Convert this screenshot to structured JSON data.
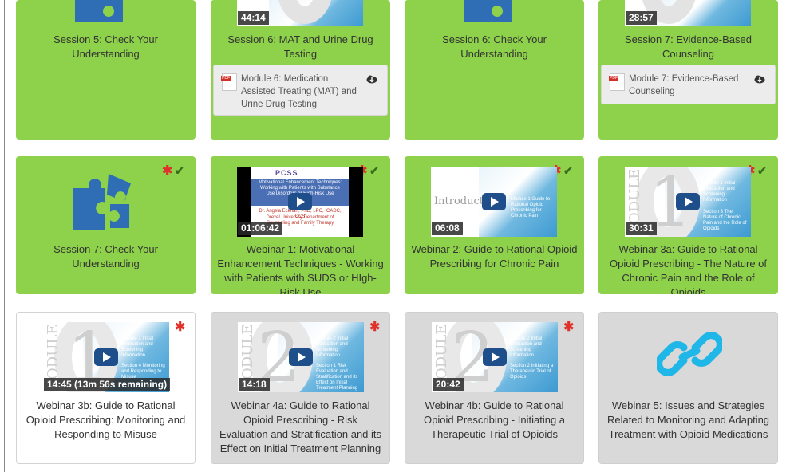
{
  "colors": {
    "completed": "#8dd24a",
    "pending": "#d9d9d9",
    "required_star": "#e0302a",
    "check": "#3a6b1e",
    "play": "#1f4f8a"
  },
  "cards": [
    {
      "title": "Session 5: Check Your Understanding",
      "icon": "puzzle-icon"
    },
    {
      "title": "Session 6: MAT and Urine Drug Testing",
      "duration": "44:14",
      "attachment": {
        "label": "Module 6: Medication Assisted Treating (MAT) and Urine Drug Testing",
        "icon": "pdf-icon",
        "action_icon": "cloud-download-icon"
      }
    },
    {
      "title": "Session 6: Check Your Understanding",
      "icon": "puzzle-icon"
    },
    {
      "title": "Session 7: Evidence-Based Counseling",
      "duration": "28:57",
      "attachment": {
        "label": "Module 7: Evidence-Based Counseling",
        "icon": "pdf-icon",
        "action_icon": "cloud-download-icon"
      }
    },
    {
      "title": "Session 7: Check Your Understanding",
      "icon": "puzzle-icon",
      "required": "✱",
      "completed": "✔"
    },
    {
      "title": "Webinar 1: Motivational Enhancement Techniques - Working with Patients with SUDS or HIgh-Risk Use",
      "duration": "01:06:42",
      "required": "✱",
      "completed": "✔",
      "slide": {
        "logo": "PCSS",
        "heading": "Motivational Enhancement Techniques: Working with Patients with Substance Use Disorders or High-Risk Use",
        "presenter": "Dr. Angela Eckhart, PhD, LPC, ICADC, CCS",
        "affiliation": "Drexel University Department of Counseling and Family Therapy"
      }
    },
    {
      "title": "Webinar 2: Guide to Rational Opioid Prescribing for Chronic Pain",
      "duration": "06:08",
      "required": "✱",
      "completed": "✔",
      "slide": {
        "heading": "Introduction",
        "subheading": "Module 1 Guide to Rational Opioid Prescribing for Chronic Pain"
      }
    },
    {
      "title": "Webinar 3a: Guide to Rational Opioid Prescribing - The Nature of Chronic Pain and the Role of Opioids",
      "duration": "30:31",
      "required": "✱",
      "completed": "✔",
      "slide": {
        "word": "ODULE",
        "number": "1",
        "subheading": "Module 1 Initial Evaluation and Screening Information",
        "section": "Section 3 The Nature of Chronic Pain and the Role of Opioids"
      }
    },
    {
      "title": "Webinar 3b: Guide to Rational Opioid Prescribing: Monitoring and Responding to Misuse",
      "duration": "14:45 (13m 56s remaining)",
      "required": "✱",
      "slide": {
        "word": "ODULE",
        "number": "1",
        "subheading": "Module 1 Initial Evaluation and Screening Information",
        "section": "Section 4 Monitoring and Responding to Misuse"
      }
    },
    {
      "title": "Webinar 4a: Guide to Rational Opioid Prescribing - Risk Evaluation and Stratification and its Effect on Initial Treatment Planning",
      "duration": "14:18",
      "required": "✱",
      "slide": {
        "word": "ODULE",
        "number": "2",
        "subheading": "Module 2 Initial Evaluation and Screening Information",
        "section": "Section 1 Risk Evaluation and Stratification and its Effect on Initial Treatment Planning"
      }
    },
    {
      "title": "Webinar 4b: Guide to Rational Opioid Prescribing - Initiating a Therapeutic Trial of Opioids",
      "duration": "20:42",
      "required": "✱",
      "slide": {
        "word": "ODULE",
        "number": "2",
        "subheading": "Module 2 Initial Evaluation and Screening Information",
        "section": "Section 2 Initiating a Therapeutic Trial of Opioids"
      }
    },
    {
      "title": "Webinar 5: Issues and Strategies Related to Monitoring and Adapting Treatment with Opioid Medications",
      "icon": "link-icon"
    }
  ]
}
